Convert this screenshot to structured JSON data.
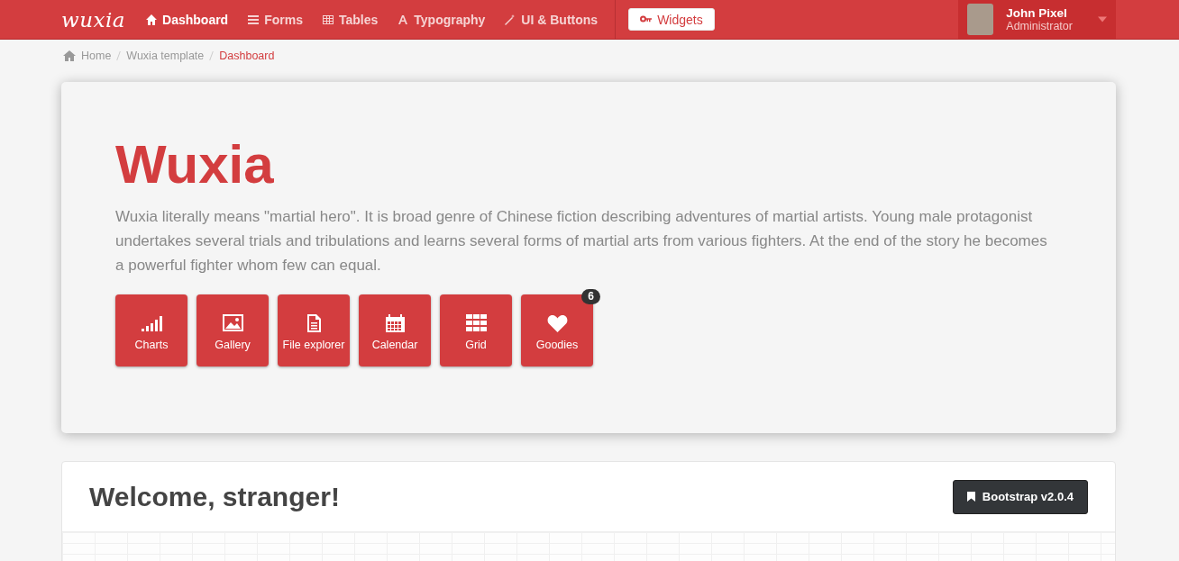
{
  "navbar": {
    "logo": "wuxia",
    "items": [
      {
        "label": "Dashboard",
        "kind": "home",
        "selected": true
      },
      {
        "label": "Forms",
        "kind": "list",
        "selected": false
      },
      {
        "label": "Tables",
        "kind": "table",
        "selected": false
      },
      {
        "label": "Typography",
        "kind": "font",
        "selected": false
      },
      {
        "label": "UI & Buttons",
        "kind": "wand",
        "selected": false
      }
    ],
    "widgets_button": "Widgets",
    "user": {
      "name": "John Pixel",
      "role": "Administrator"
    }
  },
  "breadcrumb": [
    {
      "label": "Home",
      "selected": false
    },
    {
      "label": "Wuxia template",
      "selected": false
    },
    {
      "label": "Dashboard",
      "selected": true
    }
  ],
  "hero": {
    "title": "Wuxia",
    "text": "Wuxia literally means \"martial hero\". It is broad genre of Chinese fiction describing adventures of martial artists. Young male protagonist undertakes several trials and tribulations and learns several forms of martial arts from various fighters. At the end of the story he becomes a powerful fighter whom few can equal.",
    "tiles": [
      {
        "label": "Charts",
        "kind": "signal"
      },
      {
        "label": "Gallery",
        "kind": "picture"
      },
      {
        "label": "File explorer",
        "kind": "file"
      },
      {
        "label": "Calendar",
        "kind": "calendar"
      },
      {
        "label": "Grid",
        "kind": "grid"
      },
      {
        "label": "Goodies",
        "kind": "heart",
        "badge": "6"
      }
    ]
  },
  "welcome": {
    "title": "Welcome, stranger!",
    "button": "Bootstrap v2.0.4"
  }
}
